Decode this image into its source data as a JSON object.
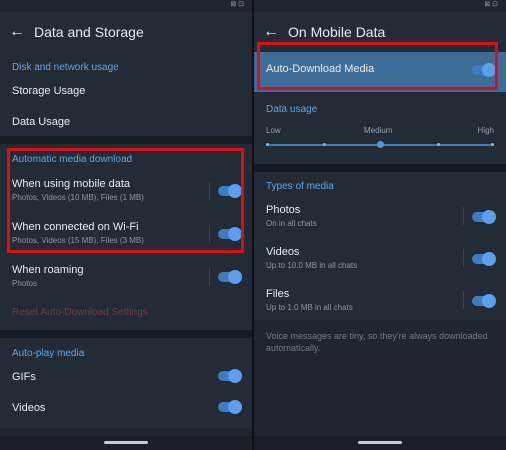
{
  "left": {
    "status": {
      "left": "",
      "right": "⊠ ⊡"
    },
    "title": "Data and Storage",
    "disk_header": "Disk and network usage",
    "storage_usage": "Storage Usage",
    "data_usage": "Data Usage",
    "auto_header": "Automatic media download",
    "mobile": {
      "title": "When using mobile data",
      "sub": "Photos, Videos (10 MB), Files (1 MB)"
    },
    "wifi": {
      "title": "When connected on Wi-Fi",
      "sub": "Photos, Videos (15 MB), Files (3 MB)"
    },
    "roaming": {
      "title": "When roaming",
      "sub": "Photos"
    },
    "reset": "Reset Auto-Download Settings",
    "autoplay_header": "Auto-play media",
    "gifs": "GIFs",
    "videos": "Videos"
  },
  "right": {
    "status": {
      "left": "",
      "right": "⊠ ⊡"
    },
    "title": "On Mobile Data",
    "auto_download": "Auto-Download Media",
    "data_usage_header": "Data usage",
    "slider": {
      "labels": [
        "Low",
        "Medium",
        "High"
      ],
      "value": "Medium"
    },
    "types_header": "Types of media",
    "photos": {
      "title": "Photos",
      "sub": "On in all chats"
    },
    "videos": {
      "title": "Videos",
      "sub": "Up to 10.0 MB in all chats"
    },
    "files": {
      "title": "Files",
      "sub": "Up to 1.0 MB in all chats"
    },
    "note": "Voice messages are tiny, so they're always downloaded automatically."
  },
  "colors": {
    "accent": "#62a5e4",
    "toggle": "#5aa0ec",
    "highlight": "#e00d15",
    "background": "#1f2630"
  },
  "icons": {
    "back": "arrow-left-icon",
    "toggle": "toggle-switch-icon"
  }
}
